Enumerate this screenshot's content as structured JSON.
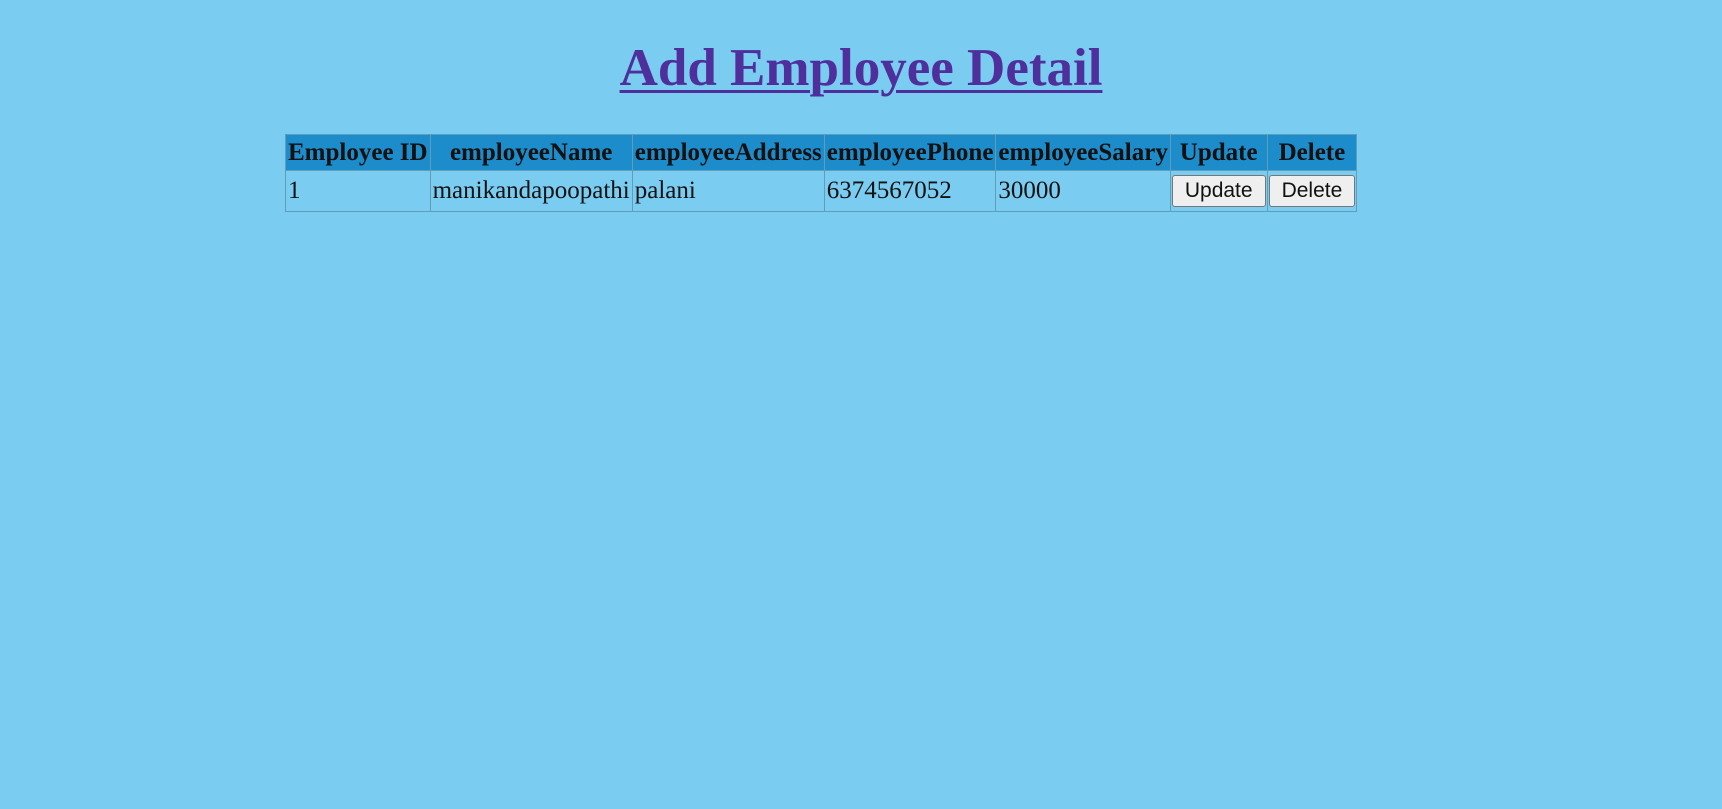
{
  "page": {
    "title": "Add Employee Detail"
  },
  "table": {
    "headers": [
      "Employee ID",
      "employeeName",
      "employeeAddress",
      "employeePhone",
      "employeeSalary",
      "Update",
      "Delete"
    ],
    "rows": [
      {
        "employee_id": "1",
        "employee_name": "manikandapoopathi",
        "employee_address": "palani",
        "employee_phone": "6374567052",
        "employee_salary": "30000",
        "update_label": "Update",
        "delete_label": "Delete"
      }
    ]
  },
  "colors": {
    "background": "#7accf1",
    "header_background": "#1d8ccb",
    "title_link": "#4f2f9b"
  }
}
